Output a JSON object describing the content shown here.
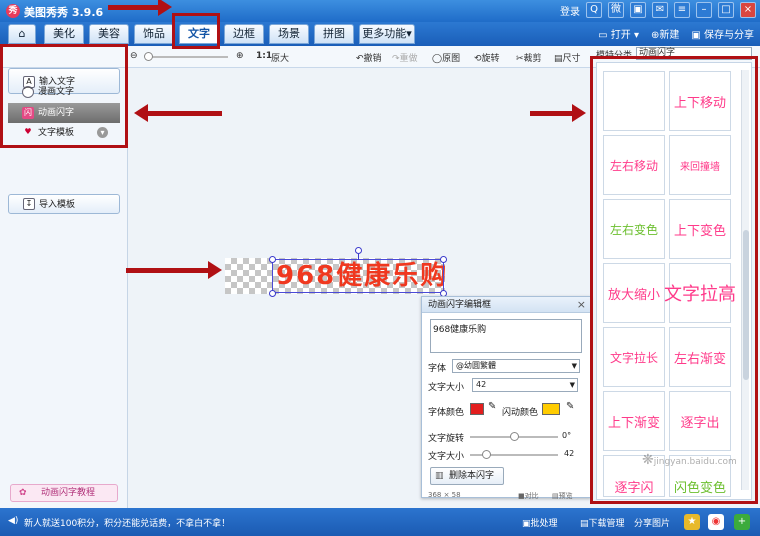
{
  "app": {
    "title": "美图秀秀 3.9.6",
    "login": "登录"
  },
  "menu": {
    "tabs": [
      "美化",
      "美容",
      "饰品",
      "文字",
      "边框",
      "场景",
      "拼图",
      "更多功能"
    ],
    "open": "打开",
    "new": "新建",
    "save": "保存与分享"
  },
  "toolbar": {
    "ratio": "1:1",
    "original": "原大",
    "undo": "撤销",
    "redo": "重做",
    "original_image": "原图",
    "rotate": "旋转",
    "crop": "裁剪",
    "size": "尺寸",
    "category_label": "模特分类",
    "category_value": "动画闪字"
  },
  "left_panel": {
    "input_text": "输入文字",
    "comic_text": "漫画文字",
    "animated_text": "动画闪字",
    "text_template": "文字模板",
    "import_template": "导入模板",
    "tutorial": "动画闪字教程"
  },
  "canvas": {
    "preview_text": "968健康乐购"
  },
  "editor": {
    "title": "动画闪字编辑框",
    "text_value": "968健康乐购",
    "font_label": "字体",
    "font_value": "@幼圆繁體",
    "size_label": "文字大小",
    "size_value": "42",
    "color_label": "字体颜色",
    "flash_color_label": "闪动颜色",
    "rotate_label": "文字旋转",
    "rotate_value": "0°",
    "scale_label": "文字大小",
    "scale_value": "42",
    "rotate_level": 0.5,
    "scale_level": 0.18,
    "delete_button": "删除本闪字",
    "text_color": "#e31e1e",
    "flash_color": "#ffcc00",
    "footer_coords": "368 × 58",
    "footer_compare": "对比",
    "footer_preview": "预览"
  },
  "templates": [
    {
      "label": "",
      "color": "#ffffff"
    },
    {
      "label": "上下移动",
      "color": "#ff3a8a"
    },
    {
      "label": "左右移动",
      "color": "#ff3a8a"
    },
    {
      "label": "来回撞墙",
      "color": "#ff3a8a"
    },
    {
      "label": "左右变色",
      "color": "#6cbf2f"
    },
    {
      "label": "上下变色",
      "color": "#ff3a8a"
    },
    {
      "label": "放大缩小",
      "color": "#ff3a8a"
    },
    {
      "label": "文字拉高",
      "color": "#ff3a8a"
    },
    {
      "label": "文字拉长",
      "color": "#ff3a8a"
    },
    {
      "label": "左右渐变",
      "color": "#ff3a8a"
    },
    {
      "label": "上下渐变",
      "color": "#ff3a8a"
    },
    {
      "label": "逐字出",
      "color": "#ff3a8a"
    },
    {
      "label": "逐字闪",
      "color": "#ff3a8a"
    },
    {
      "label": "闪色变色",
      "color": "#6cbf2f"
    }
  ],
  "status": {
    "message": "新人就送100积分，积分还能兑话费，不拿白不拿！",
    "batch": "批处理",
    "download": "下载管理",
    "share": "分享图片"
  },
  "watermark": "jingyan.baidu.com",
  "colors": {
    "annotation": "#b01014",
    "title_bar": "#1f6cc8"
  }
}
